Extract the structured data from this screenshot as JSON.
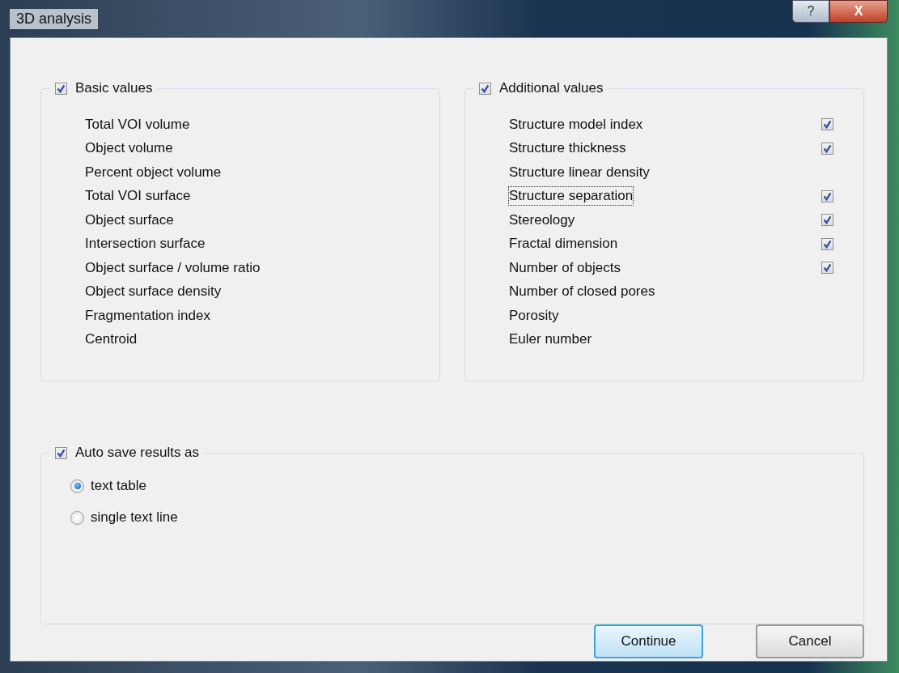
{
  "window": {
    "title": "3D analysis",
    "help_button": "?",
    "close_button": "X"
  },
  "basic": {
    "label": "Basic values",
    "checked": true,
    "items": [
      {
        "label": "Total VOI volume"
      },
      {
        "label": "Object volume"
      },
      {
        "label": "Percent object volume"
      },
      {
        "label": "Total VOI surface"
      },
      {
        "label": "Object surface"
      },
      {
        "label": "Intersection surface"
      },
      {
        "label": "Object surface / volume ratio"
      },
      {
        "label": "Object surface density"
      },
      {
        "label": "Fragmentation index"
      },
      {
        "label": "Centroid"
      }
    ]
  },
  "additional": {
    "label": "Additional values",
    "checked": true,
    "items": [
      {
        "label": "Structure model index",
        "checked": true,
        "focused": false
      },
      {
        "label": "Structure thickness",
        "checked": true,
        "focused": false
      },
      {
        "label": "Structure linear density",
        "checked": false,
        "focused": false
      },
      {
        "label": "Structure separation",
        "checked": true,
        "focused": true
      },
      {
        "label": "Stereology",
        "checked": true,
        "focused": false
      },
      {
        "label": "Fractal dimension",
        "checked": true,
        "focused": false
      },
      {
        "label": "Number of objects",
        "checked": true,
        "focused": false
      },
      {
        "label": "Number of closed pores",
        "checked": false,
        "focused": false
      },
      {
        "label": "Porosity",
        "checked": false,
        "focused": false
      },
      {
        "label": "Euler number",
        "checked": false,
        "focused": false
      }
    ]
  },
  "autosave": {
    "label": "Auto save results as",
    "checked": true,
    "options": [
      {
        "label": "text table",
        "selected": true
      },
      {
        "label": "single text line",
        "selected": false
      }
    ]
  },
  "buttons": [
    {
      "label": "Continue",
      "kind": "default"
    },
    {
      "label": "Cancel",
      "kind": "normal"
    }
  ]
}
